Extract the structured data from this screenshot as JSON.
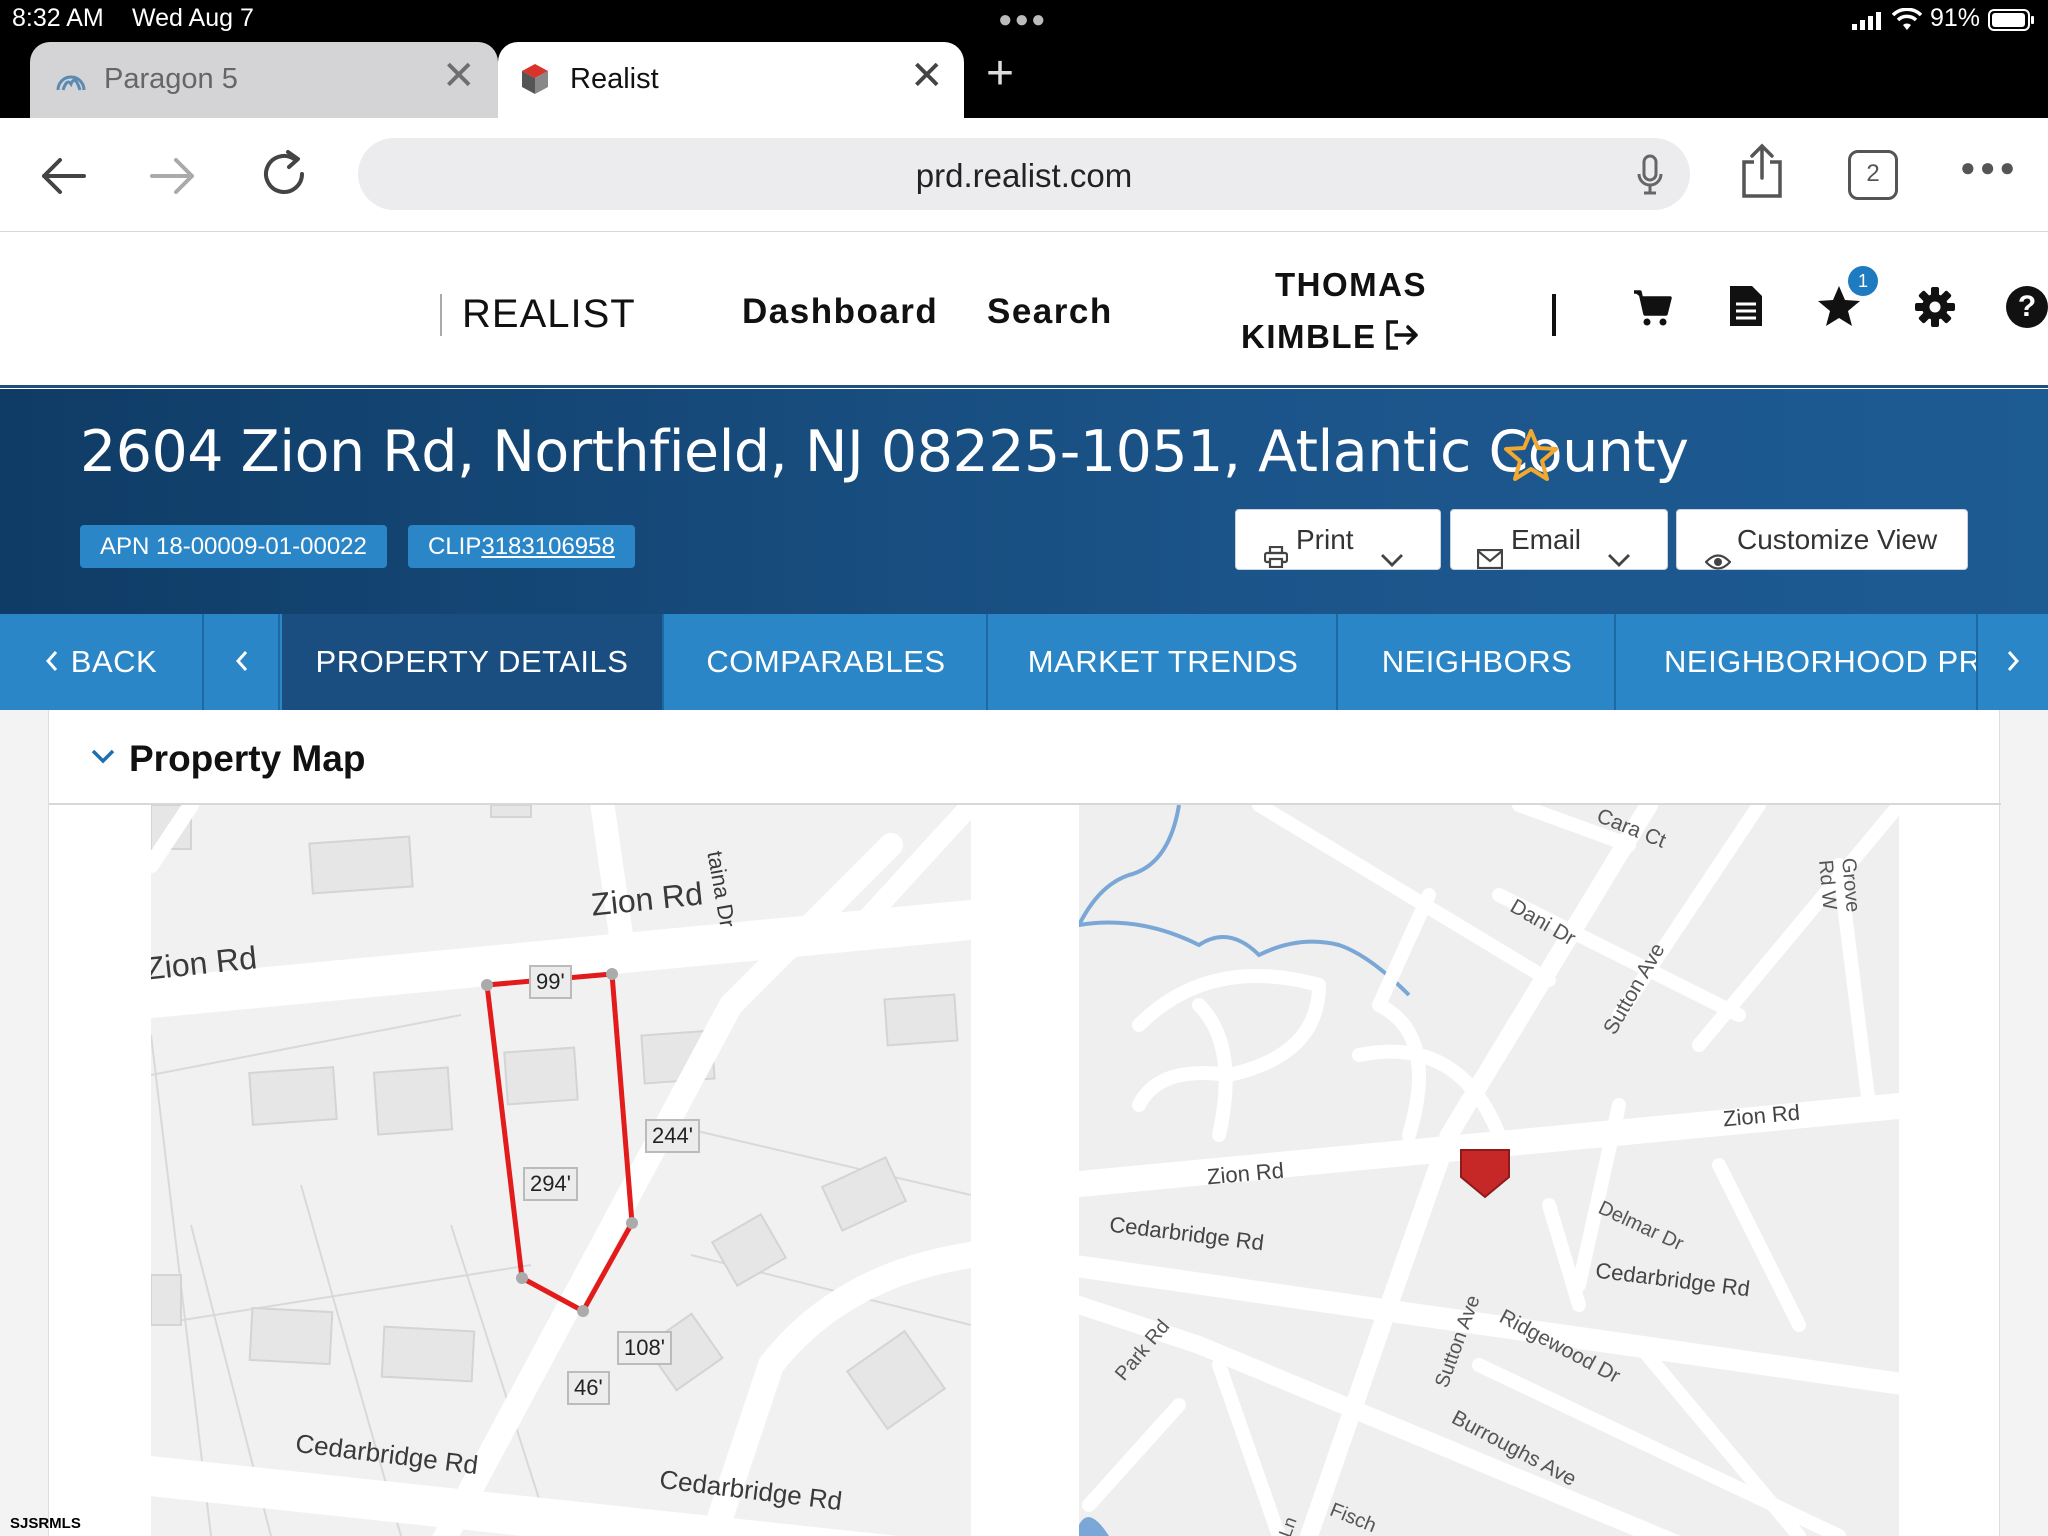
{
  "status_bar": {
    "time": "8:32 AM",
    "date": "Wed Aug 7",
    "battery": "91%"
  },
  "browser": {
    "tabs": [
      {
        "label": "Paragon 5",
        "active": false
      },
      {
        "label": "Realist",
        "active": true
      }
    ],
    "url": "prd.realist.com",
    "tab_count": "2"
  },
  "header": {
    "brand": "REALIST",
    "nav": {
      "dashboard": "Dashboard",
      "search": "Search"
    },
    "user_first": "THOMAS",
    "user_last": "KIMBLE",
    "favorites_count": "1"
  },
  "property": {
    "address": "2604 Zion Rd, Northfield, NJ 08225-1051, Atlantic County",
    "apn": "APN 18-00009-01-00022",
    "clip_prefix": "CLIP",
    "clip_number": "3183106958"
  },
  "actions": {
    "print": "Print",
    "email": "Email",
    "customize": "Customize View"
  },
  "section_tabs": {
    "back": "BACK",
    "items": [
      "PROPERTY DETAILS",
      "COMPARABLES",
      "MARKET TRENDS",
      "NEIGHBORS",
      "NEIGHBORHOOD PR"
    ]
  },
  "panel": {
    "title": "Property Map"
  },
  "parcel_map": {
    "street_labels": [
      "Zion Rd",
      "Zion Rd",
      "Cedarbridge Rd",
      "Cedarbridge Rd",
      "taina Dr"
    ],
    "dimensions": [
      "99'",
      "244'",
      "294'",
      "108'",
      "46'"
    ]
  },
  "area_map": {
    "street_labels": [
      "Cara Ct",
      "Dani Dr",
      "Grove Rd W",
      "Sutton Ave",
      "Zion Rd",
      "Zion Rd",
      "Cedarbridge Rd",
      "Delmar Dr",
      "Cedarbridge Rd",
      "Park Rd",
      "Sutton Ave",
      "Ridgewood Dr",
      "Burroughs Ave",
      "Fisch",
      "Ln"
    ]
  },
  "watermark": "SJSRMLS",
  "colors": {
    "brand_blue": "#1b5489",
    "tab_blue": "#2a86c7",
    "parcel_red": "#e21b1b",
    "star_outline": "#f0a830"
  }
}
